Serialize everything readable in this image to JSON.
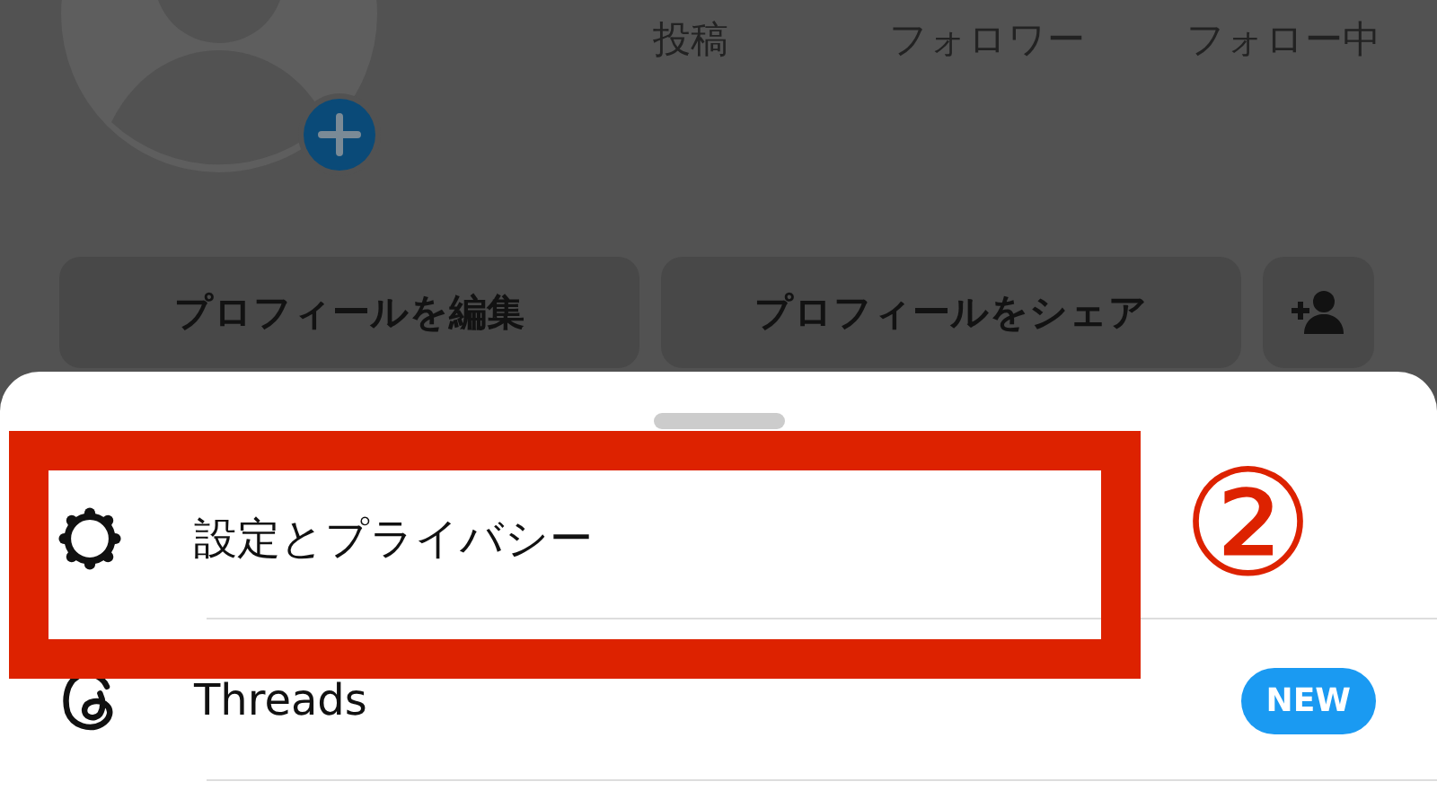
{
  "profile": {
    "stats": [
      {
        "label": "投稿"
      },
      {
        "label": "フォロワー"
      },
      {
        "label": "フォロー中"
      }
    ],
    "buttons": [
      {
        "kind": "text",
        "label": "プロフィールを編集"
      },
      {
        "kind": "text",
        "label": "プロフィールをシェア"
      },
      {
        "kind": "icon"
      }
    ]
  },
  "sheet": {
    "items": [
      {
        "kind": "settings",
        "label": "設定とプライバシー"
      },
      {
        "kind": "threads",
        "label": "Threads",
        "badge": "NEW"
      }
    ]
  },
  "annotation": {
    "marker": "②"
  }
}
